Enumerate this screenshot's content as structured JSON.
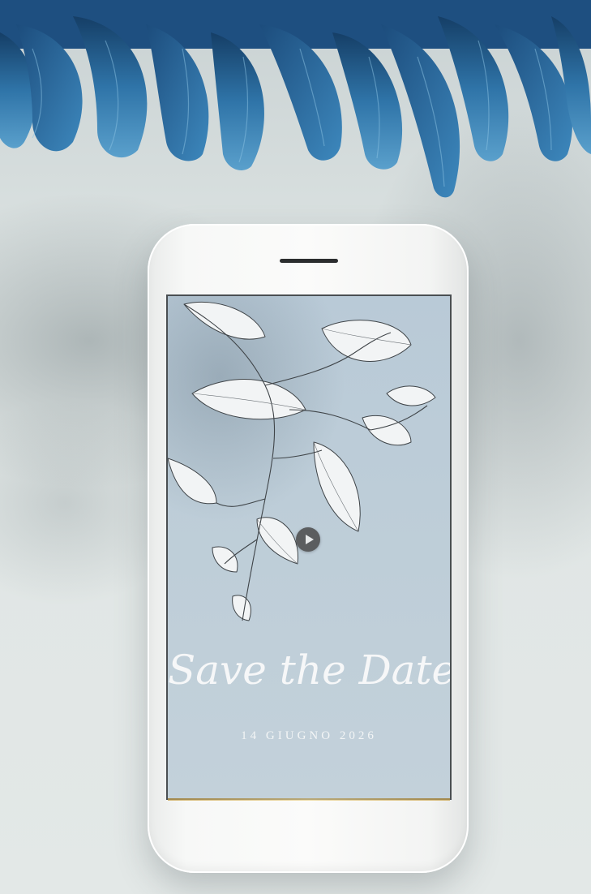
{
  "invitation": {
    "headline": "Save the Date",
    "date_line": "14 GIUGNO 2026"
  },
  "media": {
    "play_icon": "play-icon"
  },
  "colors": {
    "flowers": "#2f6d9e",
    "screen_background": "#bdcdd8",
    "phone_body": "#f7f8f7",
    "surface": "#dfe5e4"
  }
}
